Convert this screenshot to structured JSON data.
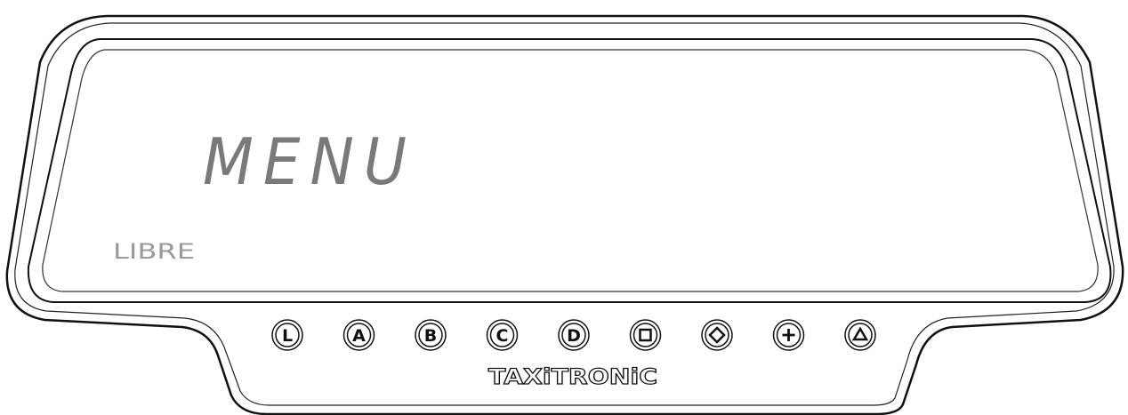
{
  "display": {
    "main_text": "MENU",
    "status_text": "LIBRE",
    "segment_color": "#7a7a7a",
    "status_color": "#9a9a9a"
  },
  "buttons": [
    {
      "name": "l-button",
      "label": "L",
      "kind": "letter"
    },
    {
      "name": "a-button",
      "label": "A",
      "kind": "letter"
    },
    {
      "name": "b-button",
      "label": "B",
      "kind": "letter"
    },
    {
      "name": "c-button",
      "label": "C",
      "kind": "letter"
    },
    {
      "name": "d-button",
      "label": "D",
      "kind": "letter"
    },
    {
      "name": "square-button",
      "label": "",
      "kind": "square-icon"
    },
    {
      "name": "diamond-button",
      "label": "",
      "kind": "diamond-icon"
    },
    {
      "name": "plus-button",
      "label": "",
      "kind": "plus-icon"
    },
    {
      "name": "triangle-button",
      "label": "",
      "kind": "triangle-icon"
    }
  ],
  "brand": {
    "logo_text": "TAXiTRONiC"
  }
}
